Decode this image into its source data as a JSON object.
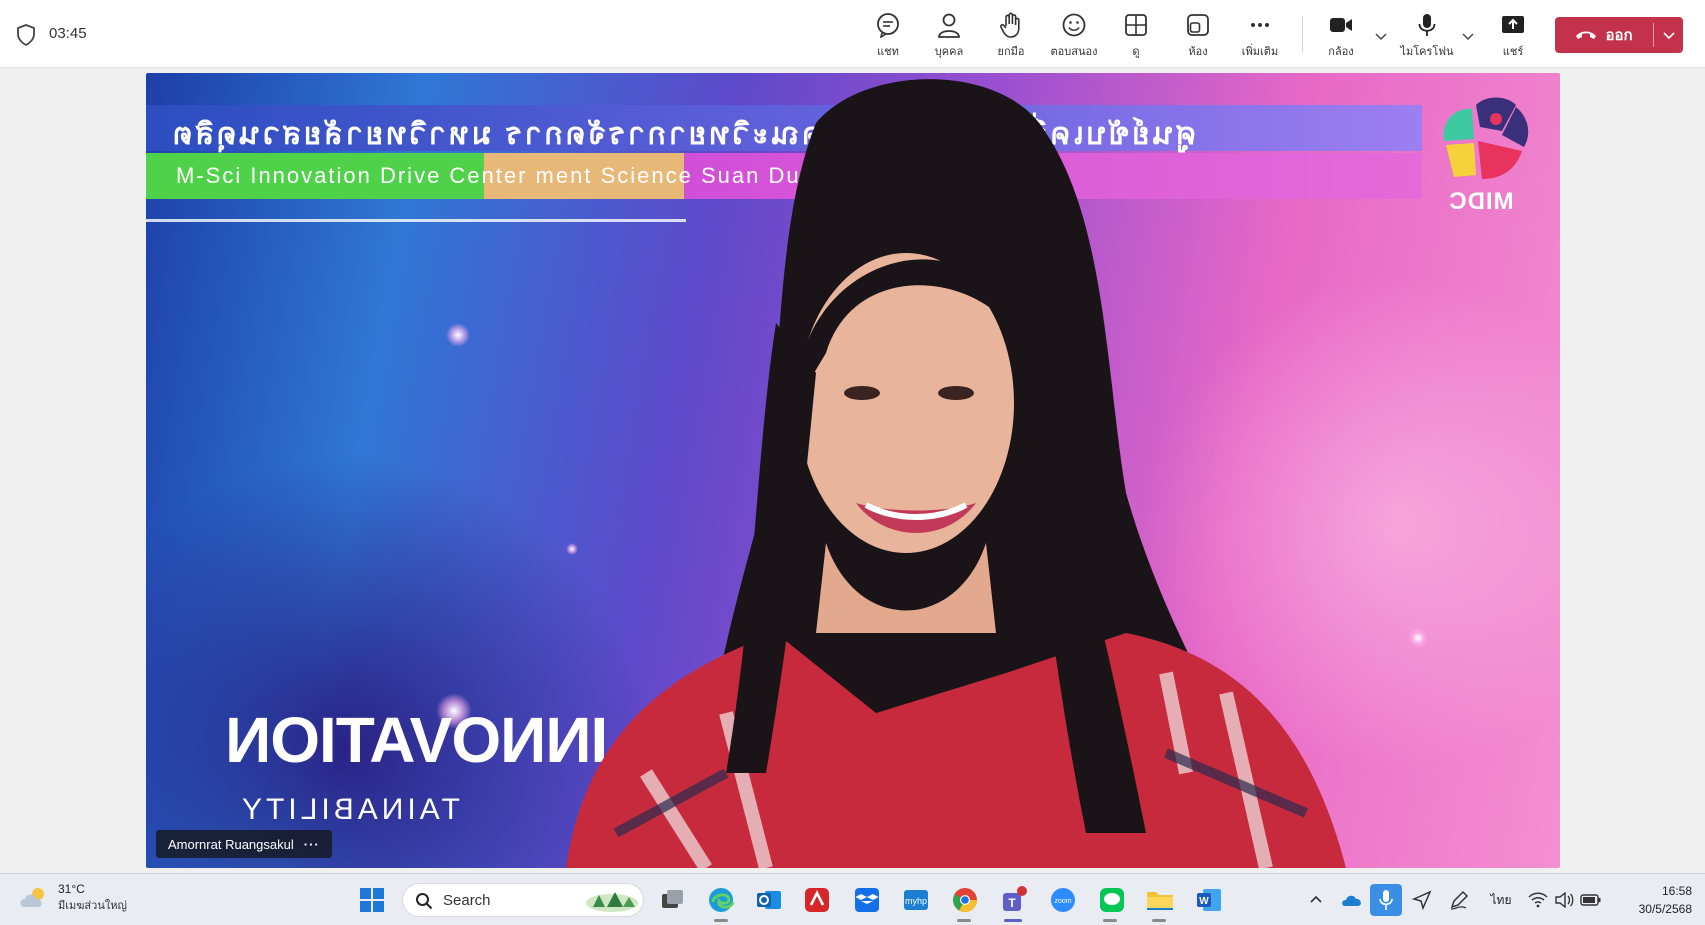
{
  "meeting": {
    "timer": "03:45",
    "toolbar": {
      "chat": "แชท",
      "people": "บุคคล",
      "raise_hand": "ยกมือ",
      "react": "ตอบสนอง",
      "view": "ดู",
      "rooms": "ห้อง",
      "more": "เพิ่มเติม",
      "camera": "กล้อง",
      "mic": "ไมโครโฟน",
      "share": "แชร์",
      "leave": "ออก"
    },
    "colors": {
      "leave": "#c4314b",
      "accent": "#5b5fc7"
    }
  },
  "video": {
    "banner_thai": "ศูนย์ขับเคลื่อนนวัตกรรม คณะวิทยาการจัดการ มหาวิทยาลัยสวนดุสิต",
    "banner_en": "M-Sci Innovation Drive Center  ment Science  Suan Dusit University",
    "logo_text": "MIDC",
    "slogan_big": "INNOVATION",
    "slogan_small": "TAINABILITY",
    "participant_name": "Amornrat Ruangsakul",
    "more_dots": "···"
  },
  "taskbar": {
    "weather_temp": "31°C",
    "weather_desc": "มีเมฆส่วนใหญ่",
    "search_placeholder": "Search",
    "input_lang": "ไทย",
    "time": "16:58",
    "date": "30/5/2568"
  }
}
